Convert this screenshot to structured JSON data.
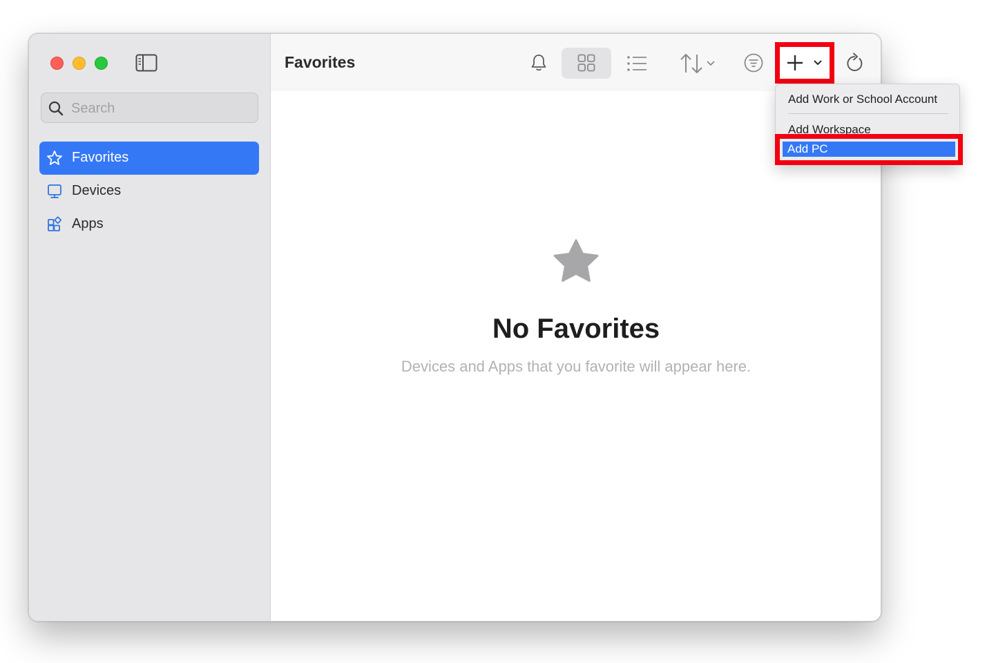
{
  "sidebar": {
    "search_placeholder": "Search",
    "items": [
      {
        "label": "Favorites",
        "icon": "star-outline-icon",
        "active": true
      },
      {
        "label": "Devices",
        "icon": "monitor-icon",
        "active": false
      },
      {
        "label": "Apps",
        "icon": "apps-grid-icon",
        "active": false
      }
    ]
  },
  "toolbar": {
    "title": "Favorites",
    "icons": [
      "bell-icon",
      "grid-view-icon",
      "list-view-icon",
      "sort-icon",
      "filter-icon",
      "plus-icon",
      "refresh-icon"
    ]
  },
  "empty_state": {
    "title": "No Favorites",
    "subtitle": "Devices and Apps that you favorite will appear here."
  },
  "add_menu": {
    "items": [
      {
        "label": "Add Work or School Account"
      },
      {
        "label": "Add Workspace"
      },
      {
        "label": "Add PC",
        "highlighted": true
      }
    ]
  },
  "colors": {
    "accent": "#3478f6",
    "annotation": "#f20011",
    "sidebar_bg": "#e6e6e8"
  }
}
